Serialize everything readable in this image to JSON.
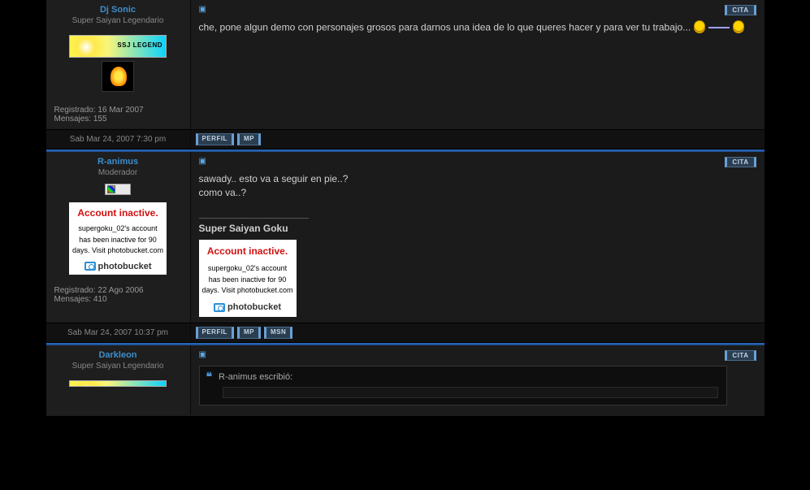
{
  "buttons": {
    "cita": "CITA",
    "perfil": "PERFIL",
    "mp": "MP",
    "msn": "MSN"
  },
  "labels": {
    "registrado": "Registrado:",
    "mensajes": "Mensajes:",
    "escribio": "escribió:"
  },
  "photobucket": {
    "title": "Account inactive.",
    "text": "supergoku_02's account has been inactive for 90 days. Visit photobucket.com",
    "brand": "photobucket"
  },
  "ssj_legend": "SSJ LEGEND",
  "posts": [
    {
      "author": "Dj Sonic",
      "rank": "Super Saiyan Legendario",
      "registered": "16 Mar 2007",
      "messages": "155",
      "date": "Sab Mar 24, 2007 7:30 pm",
      "content": "che, pone algun demo con personajes grosos para darnos una idea de lo que queres hacer y para ver tu trabajo...",
      "footer_buttons": [
        "perfil",
        "mp"
      ]
    },
    {
      "author": "R-animus",
      "rank": "Moderador",
      "registered": "22 Ago 2006",
      "messages": "410",
      "date": "Sab Mar 24, 2007 10:37 pm",
      "content_line1": "sawady.. esto va a seguir en pie..?",
      "content_line2": "como va..?",
      "sig": "Super Saiyan Goku",
      "footer_buttons": [
        "perfil",
        "mp",
        "msn"
      ]
    },
    {
      "author": "Darkleon",
      "rank": "Super Saiyan Legendario",
      "quote_author": "R-animus"
    }
  ]
}
